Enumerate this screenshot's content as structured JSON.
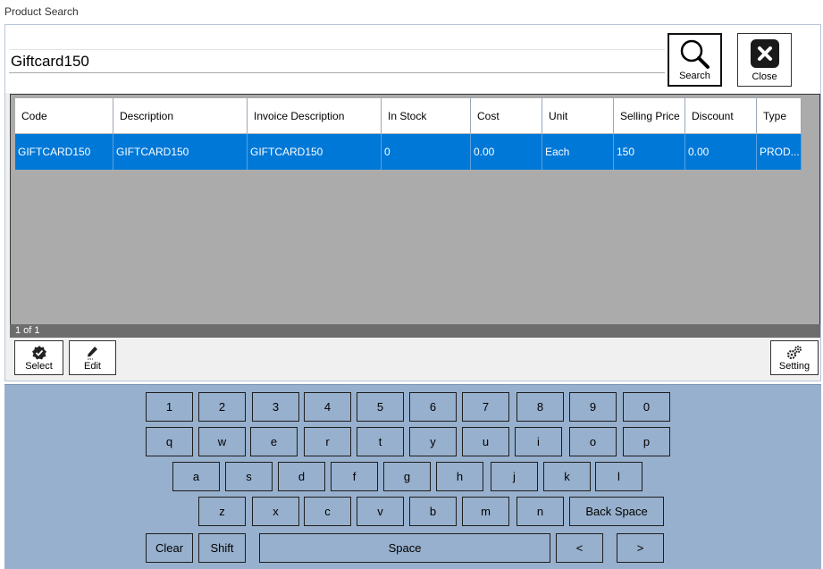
{
  "window": {
    "title": "Product Search"
  },
  "search": {
    "value": "Giftcard150",
    "button_label": "Search",
    "close_label": "Close"
  },
  "grid": {
    "columns": [
      "Code",
      "Description",
      "Invoice Description",
      "In Stock",
      "Cost",
      "Unit",
      "Selling Price",
      "Discount",
      "Type"
    ],
    "rows": [
      [
        "GIFTCARD150",
        "GIFTCARD150",
        "GIFTCARD150",
        "0",
        "0.00",
        "Each",
        "150",
        "0.00",
        "PROD..."
      ]
    ],
    "pager": "1 of 1"
  },
  "actions": {
    "select_label": "Select",
    "edit_label": "Edit",
    "setting_label": "Setting"
  },
  "keyboard": {
    "row1": [
      "1",
      "2",
      "3",
      "4",
      "5",
      "6",
      "7",
      "8",
      "9",
      "0"
    ],
    "row2": [
      "q",
      "w",
      "e",
      "r",
      "t",
      "y",
      "u",
      "i",
      "o",
      "p"
    ],
    "row3": [
      "a",
      "s",
      "d",
      "f",
      "g",
      "h",
      "j",
      "k",
      "l"
    ],
    "row4": [
      "z",
      "x",
      "c",
      "v",
      "b",
      "m",
      "n"
    ],
    "backspace": "Back Space",
    "clear": "Clear",
    "shift": "Shift",
    "space": "Space",
    "left": "<",
    "right": ">"
  },
  "colors": {
    "selection": "#0078d7",
    "keyboard_bg": "#97b0cd",
    "grid_bg": "#ababab"
  },
  "icons": [
    "search-icon",
    "close-icon",
    "check-badge-icon",
    "edit-pencil-icon",
    "gears-icon"
  ]
}
